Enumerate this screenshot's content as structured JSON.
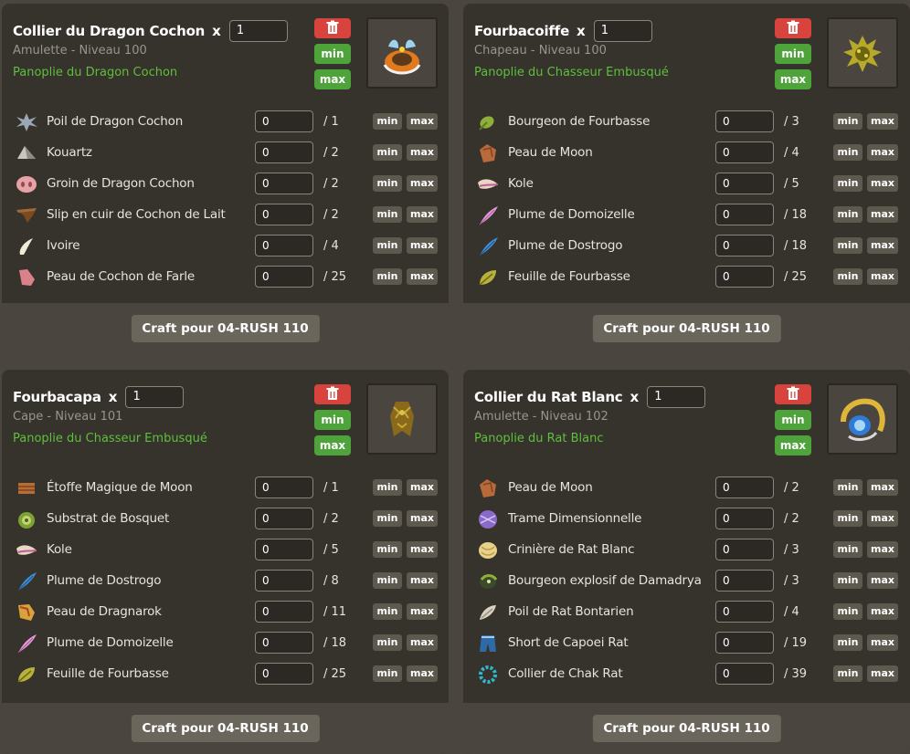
{
  "cards": [
    {
      "name": "Collier du Dragon Cochon",
      "times": "x",
      "quantity": "1",
      "type_level": "Amulette - Niveau 100",
      "set": "Panoplie du Dragon Cochon",
      "icon": "dragon-pig-amulet-icon",
      "min_label": "min",
      "max_label": "max",
      "craft_label": "Craft pour 04-RUSH 110",
      "resources": [
        {
          "name": "Poil de Dragon Cochon",
          "value": "0",
          "needed": "/ 1",
          "icon": "spiky-hair-icon"
        },
        {
          "name": "Kouartz",
          "value": "0",
          "needed": "/ 2",
          "icon": "stone-icon"
        },
        {
          "name": "Groin de Dragon Cochon",
          "value": "0",
          "needed": "/ 2",
          "icon": "pig-snout-icon"
        },
        {
          "name": "Slip en cuir de Cochon de Lait",
          "value": "0",
          "needed": "/ 2",
          "icon": "leather-slip-icon"
        },
        {
          "name": "Ivoire",
          "value": "0",
          "needed": "/ 4",
          "icon": "ivory-icon"
        },
        {
          "name": "Peau de Cochon de Farle",
          "value": "0",
          "needed": "/ 25",
          "icon": "pig-skin-icon"
        }
      ]
    },
    {
      "name": "Fourbacoiffe",
      "times": "x",
      "quantity": "1",
      "type_level": "Chapeau - Niveau 100",
      "set": "Panoplie du Chasseur Embusqué",
      "icon": "leafy-hat-icon",
      "min_label": "min",
      "max_label": "max",
      "craft_label": "Craft pour 04-RUSH 110",
      "resources": [
        {
          "name": "Bourgeon de Fourbasse",
          "value": "0",
          "needed": "/ 3",
          "icon": "bud-icon"
        },
        {
          "name": "Peau de Moon",
          "value": "0",
          "needed": "/ 4",
          "icon": "moon-skin-icon"
        },
        {
          "name": "Kole",
          "value": "0",
          "needed": "/ 5",
          "icon": "kole-icon"
        },
        {
          "name": "Plume de Domoizelle",
          "value": "0",
          "needed": "/ 18",
          "icon": "pink-feather-icon"
        },
        {
          "name": "Plume de Dostrogo",
          "value": "0",
          "needed": "/ 18",
          "icon": "blue-feather-icon"
        },
        {
          "name": "Feuille de Fourbasse",
          "value": "0",
          "needed": "/ 25",
          "icon": "leaf-icon"
        }
      ]
    },
    {
      "name": "Fourbacapa",
      "times": "x",
      "quantity": "1",
      "type_level": "Cape - Niveau 101",
      "set": "Panoplie du Chasseur Embusqué",
      "icon": "leafy-cape-icon",
      "min_label": "min",
      "max_label": "max",
      "craft_label": "Craft pour 04-RUSH 110",
      "resources": [
        {
          "name": "Étoffe Magique de Moon",
          "value": "0",
          "needed": "/ 1",
          "icon": "magic-cloth-icon"
        },
        {
          "name": "Substrat de Bosquet",
          "value": "0",
          "needed": "/ 2",
          "icon": "substrate-icon"
        },
        {
          "name": "Kole",
          "value": "0",
          "needed": "/ 5",
          "icon": "kole-icon"
        },
        {
          "name": "Plume de Dostrogo",
          "value": "0",
          "needed": "/ 8",
          "icon": "blue-feather-icon"
        },
        {
          "name": "Peau de Dragnarok",
          "value": "0",
          "needed": "/ 11",
          "icon": "dragnarok-skin-icon"
        },
        {
          "name": "Plume de Domoizelle",
          "value": "0",
          "needed": "/ 18",
          "icon": "pink-feather-icon"
        },
        {
          "name": "Feuille de Fourbasse",
          "value": "0",
          "needed": "/ 25",
          "icon": "leaf-icon"
        }
      ]
    },
    {
      "name": "Collier du Rat Blanc",
      "times": "x",
      "quantity": "1",
      "type_level": "Amulette - Niveau 102",
      "set": "Panoplie du Rat Blanc",
      "icon": "white-rat-amulet-icon",
      "min_label": "min",
      "max_label": "max",
      "craft_label": "Craft pour 04-RUSH 110",
      "resources": [
        {
          "name": "Peau de Moon",
          "value": "0",
          "needed": "/ 2",
          "icon": "moon-skin-icon"
        },
        {
          "name": "Trame Dimensionnelle",
          "value": "0",
          "needed": "/ 2",
          "icon": "dimensional-weft-icon"
        },
        {
          "name": "Crinière de Rat Blanc",
          "value": "0",
          "needed": "/ 3",
          "icon": "mane-icon"
        },
        {
          "name": "Bourgeon explosif de Damadrya",
          "value": "0",
          "needed": "/ 3",
          "icon": "explosive-bud-icon"
        },
        {
          "name": "Poil de Rat Bontarien",
          "value": "0",
          "needed": "/ 4",
          "icon": "rat-hair-icon"
        },
        {
          "name": "Short de Capoei Rat",
          "value": "0",
          "needed": "/ 19",
          "icon": "shorts-icon"
        },
        {
          "name": "Collier de Chak Rat",
          "value": "0",
          "needed": "/ 39",
          "icon": "chak-collar-icon"
        }
      ]
    }
  ]
}
